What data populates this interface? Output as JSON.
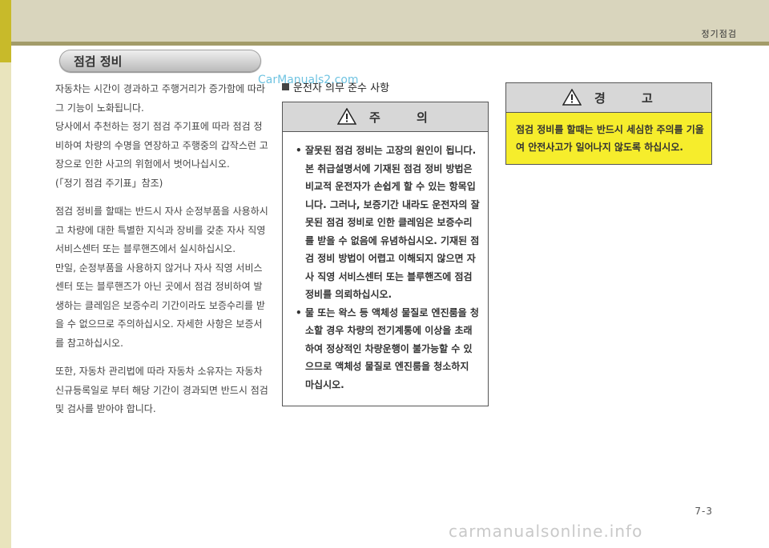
{
  "header": {
    "title": "정기점검"
  },
  "pill": {
    "label": "점검 정비"
  },
  "body": {
    "paragraphs": [
      "자동차는 시간이 경과하고 주행거리가 증가함에 따라 그 기능이 노화됩니다.",
      "당사에서 추천하는 정기 점검 주기표에 따라 점검 정비하여 차량의 수명을 연장하고 주행중의 갑작스런 고장으로 인한 사고의 위험에서 벗어나십시오.",
      "(「정기 점검 주기표」참조)",
      "점검 정비를 할때는 반드시 자사 순정부품을 사용하시고 차량에 대한 특별한 지식과 장비를 갖춘 자사 직영 서비스센터 또는 블루핸즈에서 실시하십시오.",
      "만일, 순정부품을 사용하지 않거나 자사 직영 서비스센터 또는 블루핸즈가 아닌 곳에서 점검 정비하여 발생하는 클레임은 보증수리 기간이라도 보증수리를 받을 수 없으므로 주의하십시오. 자세한 사항은 보증서를 참고하십시오.",
      "또한, 자동차 관리법에 따라 자동차 소유자는 자동차 신규등록일로 부터 해당 기간이 경과되면 반드시 점검 및 검사를 받아야 합니다."
    ]
  },
  "section": {
    "heading": "운전자 의무 준수 사항"
  },
  "watermark_small": "CarManuals2.com",
  "caution": {
    "title": "주 의",
    "items": [
      "잘못된 점검 정비는 고장의 원인이 됩니다. 본 취급설명서에 기재된 점검 정비 방법은 비교적 운전자가 손쉽게 할 수 있는 항목입니다. 그러나, 보증기간 내라도 운전자의 잘못된 점검 정비로 인한 클레임은 보증수리를 받을 수 없음에 유념하십시오. 기재된 점검 정비 방법이 어렵고 이해되지 않으면 자사 직영 서비스센터 또는 블루핸즈에 점검 정비를 의뢰하십시오.",
      "물 또는 왁스 등 액체성 물질로 엔진룸을 청소할 경우 차량의 전기계통에 이상을 초래하여 정상적인 차량운행이 불가능할 수 있으므로 액체성 물질로 엔진룸을 청소하지 마십시오."
    ]
  },
  "warning": {
    "title": "경 고",
    "text": "점검 정비를 할때는 반드시 세심한 주의를 기울여 안전사고가 일어나지 않도록 하십시오."
  },
  "page_number": "7-3",
  "footer_watermark": "carmanualsonline.info"
}
